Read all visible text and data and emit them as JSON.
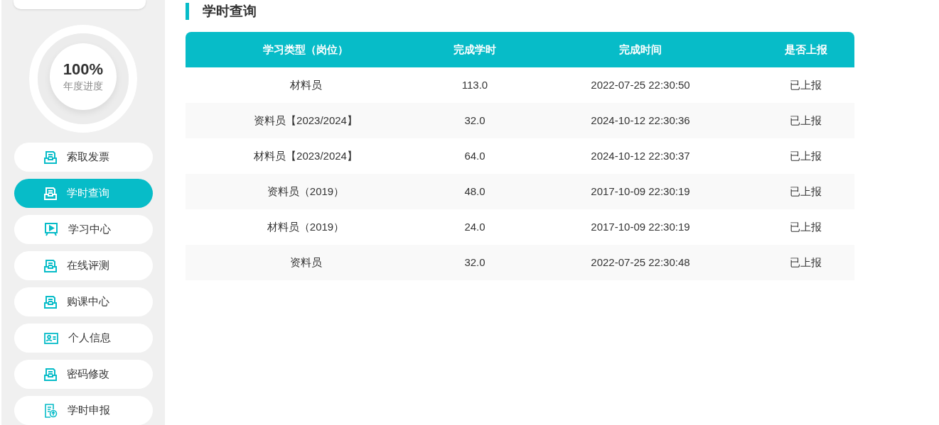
{
  "progress": {
    "value": "100%",
    "label": "年度进度",
    "level": 1
  },
  "menu": [
    {
      "label": "索取发票",
      "selected": false
    },
    {
      "label": "学时查询",
      "selected": true
    },
    {
      "label": "学习中心",
      "selected": false
    },
    {
      "label": "在线评测",
      "selected": false
    },
    {
      "label": "购课中心",
      "selected": false
    },
    {
      "label": "个人信息",
      "selected": false
    },
    {
      "label": "密码修改",
      "selected": false
    },
    {
      "label": "学时申报",
      "selected": false
    }
  ],
  "section_title": "学时查询",
  "table": {
    "columns": [
      "学习类型（岗位）",
      "完成学时",
      "完成时间",
      "是否上报"
    ],
    "rows": [
      [
        "材料员",
        "113.0",
        "2022-07-25 22:30:50",
        "已上报"
      ],
      [
        "资料员【2023/2024】",
        "32.0",
        "2024-10-12 22:30:36",
        "已上报"
      ],
      [
        "材料员【2023/2024】",
        "64.0",
        "2024-10-12 22:30:37",
        "已上报"
      ],
      [
        "资料员（2019）",
        "48.0",
        "2017-10-09 22:30:19",
        "已上报"
      ],
      [
        "材料员（2019）",
        "24.0",
        "2017-10-09 22:30:19",
        "已上报"
      ],
      [
        "资料员",
        "32.0",
        "2022-07-25 22:30:48",
        "已上报"
      ]
    ]
  }
}
